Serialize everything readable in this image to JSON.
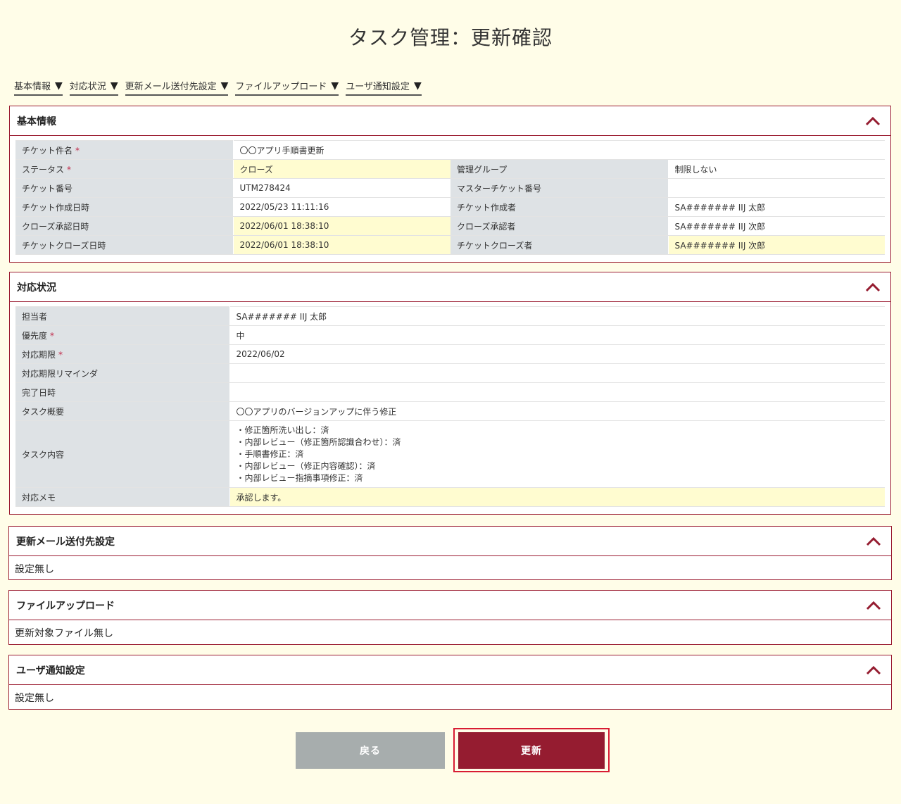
{
  "page": {
    "title": "タスク管理：更新確認"
  },
  "nav": [
    {
      "label": "基本情報"
    },
    {
      "label": "対応状況"
    },
    {
      "label": "更新メール送付先設定"
    },
    {
      "label": "ファイルアップロード"
    },
    {
      "label": "ユーザ通知設定"
    }
  ],
  "nav_arrow": "▼",
  "basic": {
    "title": "基本情報",
    "subject_label": "チケット件名",
    "subject_value": "〇〇アプリ手順書更新",
    "status_label": "ステータス",
    "status_value": "クローズ",
    "group_label": "管理グループ",
    "group_value": "制限しない",
    "number_label": "チケット番号",
    "number_value": "UTM278424",
    "master_label": "マスターチケット番号",
    "master_value": "",
    "created_label": "チケット作成日時",
    "created_value": "2022/05/23 11:11:16",
    "creator_label": "チケット作成者",
    "creator_value": "SA####### IIJ 太郎",
    "close_approved_label": "クローズ承認日時",
    "close_approved_value": "2022/06/01 18:38:10",
    "close_approver_label": "クローズ承認者",
    "close_approver_value": "SA####### IIJ 次郎",
    "closed_label": "チケットクローズ日時",
    "closed_value": "2022/06/01 18:38:10",
    "closer_label": "チケットクローズ者",
    "closer_value": "SA####### IIJ 次郎"
  },
  "status": {
    "title": "対応状況",
    "assignee_label": "担当者",
    "assignee_value": "SA####### IIJ 太郎",
    "priority_label": "優先度",
    "priority_value": "中",
    "due_label": "対応期限",
    "due_value": "2022/06/02",
    "reminder_label": "対応期限リマインダ",
    "reminder_value": "",
    "completed_label": "完了日時",
    "completed_value": "",
    "summary_label": "タスク概要",
    "summary_value": "〇〇アプリのバージョンアップに伴う修正",
    "content_label": "タスク内容",
    "content_lines": [
      "・修正箇所洗い出し：済",
      "・内部レビュー（修正箇所認識合わせ）：済",
      "・手順書修正：済",
      "・内部レビュー（修正内容確認）：済",
      "・内部レビュー指摘事項修正：済"
    ],
    "memo_label": "対応メモ",
    "memo_value": "承認します。"
  },
  "required_mark": "*",
  "mail": {
    "title": "更新メール送付先設定",
    "body": "設定無し"
  },
  "upload": {
    "title": "ファイルアップロード",
    "body": "更新対象ファイル無し"
  },
  "notify": {
    "title": "ユーザ通知設定",
    "body": "設定無し"
  },
  "buttons": {
    "back": "戻る",
    "update": "更新"
  },
  "colors": {
    "accent": "#951c30",
    "highlight": "#fffcd0",
    "label_bg": "#dee2e5",
    "page_bg": "#fffde8"
  }
}
